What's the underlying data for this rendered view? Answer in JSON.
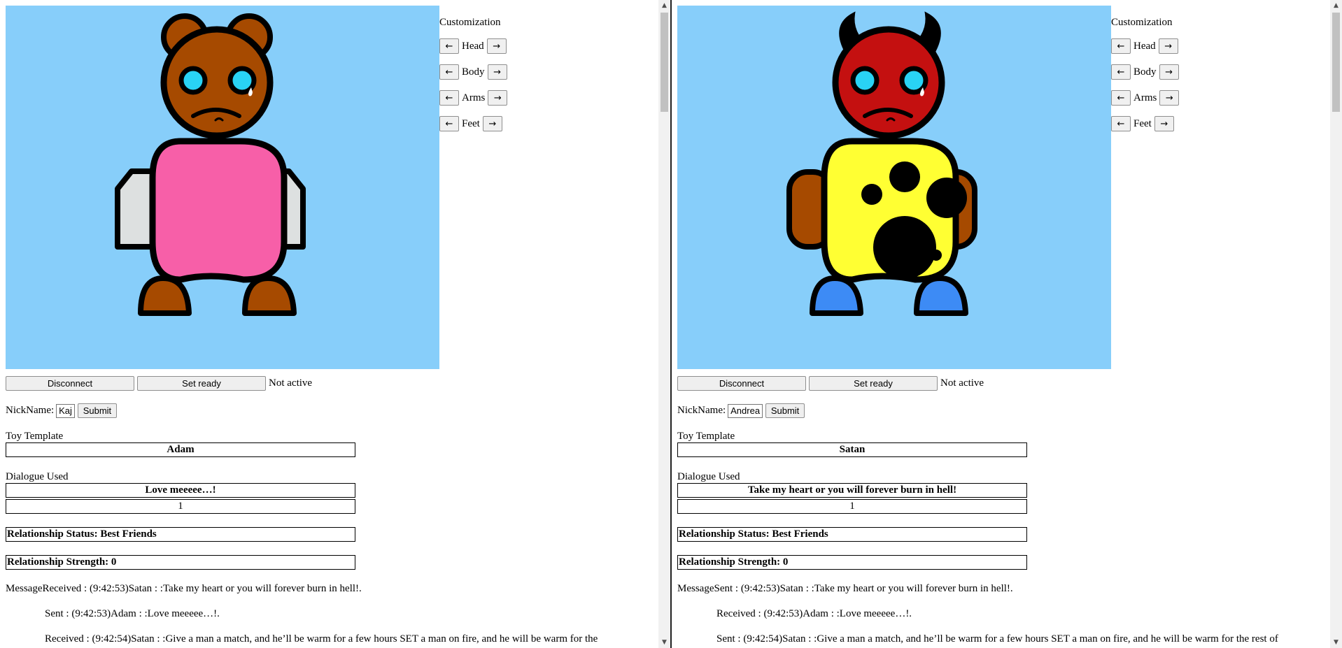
{
  "panes": [
    {
      "id": "left",
      "customization": {
        "title": "Customization",
        "rows": [
          "Head",
          "Body",
          "Arms",
          "Feet"
        ],
        "prev": "←",
        "next": "→"
      },
      "buttons": {
        "disconnect": "Disconnect",
        "set_ready": "Set ready",
        "status": "Not active"
      },
      "nickname": {
        "label": "NickName:",
        "value": "Kaj",
        "submit": "Submit"
      },
      "toy_template": {
        "label": "Toy Template",
        "value": "Adam"
      },
      "dialogue": {
        "label": "Dialogue Used",
        "text": "Love meeeee…!",
        "count": "1"
      },
      "relationship_status": "Relationship Status: Best Friends",
      "relationship_strength": "Relationship Strength: 0",
      "messages": [
        "MessageReceived : (9:42:53)Satan : :Take my heart or you will forever burn in hell!.",
        "Sent : (9:42:53)Adam : :Love meeeee…!.",
        "Received : (9:42:54)Satan : :Give a man a match, and he’ll be warm for a few hours SET a man on fire, and he will be warm for the"
      ],
      "toy": {
        "head_color": "#a64a00",
        "body_color": "#f75fa8",
        "arms_color": "#dde0e0",
        "feet_color": "#a64a00",
        "eye_color": "#29d3f5",
        "head_style": "bear-ears",
        "body_pattern": "plain",
        "arm_style": "fins"
      }
    },
    {
      "id": "right",
      "customization": {
        "title": "Customization",
        "rows": [
          "Head",
          "Body",
          "Arms",
          "Feet"
        ],
        "prev": "←",
        "next": "→"
      },
      "buttons": {
        "disconnect": "Disconnect",
        "set_ready": "Set ready",
        "status": "Not active"
      },
      "nickname": {
        "label": "NickName:",
        "value": "Andrea",
        "submit": "Submit"
      },
      "toy_template": {
        "label": "Toy Template",
        "value": "Satan"
      },
      "dialogue": {
        "label": "Dialogue Used",
        "text": "Take my heart or you will forever burn in hell!",
        "count": "1"
      },
      "relationship_status": "Relationship Status: Best Friends",
      "relationship_strength": "Relationship Strength: 0",
      "messages": [
        "MessageSent : (9:42:53)Satan : :Take my heart or you will forever burn in hell!.",
        "Received : (9:42:53)Adam : :Love meeeee…!.",
        "Sent : (9:42:54)Satan : :Give a man a match, and he’ll be warm for a few hours SET a man on fire, and he will be warm for the rest of"
      ],
      "toy": {
        "head_color": "#c41010",
        "body_color": "#ffff33",
        "arms_color": "#a64a00",
        "feet_color": "#3d8bf5",
        "eye_color": "#29d3f5",
        "head_style": "devil-horns",
        "body_pattern": "cheese-spots",
        "arm_style": "rounded"
      }
    }
  ]
}
